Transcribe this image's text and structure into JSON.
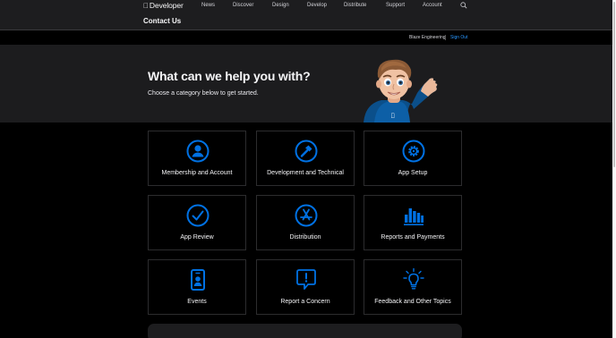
{
  "globalnav": {
    "logo_text": "Developer",
    "items": [
      "News",
      "Discover",
      "Design",
      "Develop",
      "Distribute",
      "Support",
      "Account"
    ]
  },
  "localnav": {
    "title": "Contact Us"
  },
  "userbar": {
    "team": "Blaze Engineering",
    "signout": "Sign Out"
  },
  "hero": {
    "title": "What can we help you with?",
    "subtitle": "Choose a category below to get started."
  },
  "categories": [
    {
      "label": "Membership and Account",
      "icon": "person-circle-icon"
    },
    {
      "label": "Development and Technical",
      "icon": "hammer-circle-icon"
    },
    {
      "label": "App Setup",
      "icon": "gear-circle-icon"
    },
    {
      "label": "App Review",
      "icon": "checkmark-circle-icon"
    },
    {
      "label": "Distribution",
      "icon": "app-store-icon"
    },
    {
      "label": "Reports and Payments",
      "icon": "bar-chart-icon"
    },
    {
      "label": "Events",
      "icon": "badge-icon"
    },
    {
      "label": "Report a Concern",
      "icon": "exclamation-bubble-icon"
    },
    {
      "label": "Feedback and Other Topics",
      "icon": "lightbulb-icon"
    }
  ],
  "colors": {
    "accent": "#0071e3",
    "link": "#2997ff",
    "background": "#000000"
  }
}
